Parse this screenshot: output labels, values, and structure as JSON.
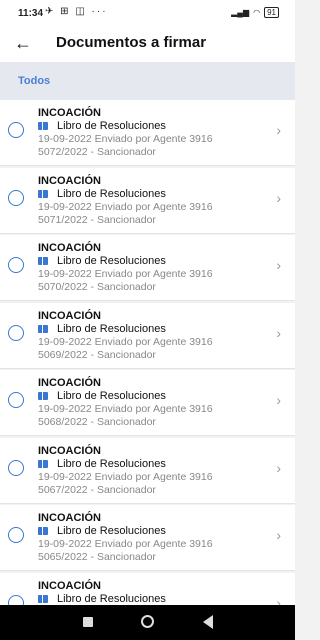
{
  "status_bar": {
    "time": "11:34",
    "left_icons": "✈ ⊞ ◫ ···",
    "battery": "91"
  },
  "header": {
    "back_icon": "arrow-left-icon",
    "title": "Documentos a firmar"
  },
  "tabs": [
    {
      "label": "Todos",
      "active": true
    }
  ],
  "documents": [
    {
      "type": "INCOACIÓN",
      "book": "Libro de Resoluciones",
      "sent": "19-09-2022 Enviado por Agente 3916",
      "ref": "5072/2022 - Sancionador"
    },
    {
      "type": "INCOACIÓN",
      "book": "Libro de Resoluciones",
      "sent": "19-09-2022 Enviado por Agente 3916",
      "ref": "5071/2022 - Sancionador"
    },
    {
      "type": "INCOACIÓN",
      "book": "Libro de Resoluciones",
      "sent": "19-09-2022 Enviado por Agente 3916",
      "ref": "5070/2022 - Sancionador"
    },
    {
      "type": "INCOACIÓN",
      "book": "Libro de Resoluciones",
      "sent": "19-09-2022 Enviado por Agente 3916",
      "ref": "5069/2022 - Sancionador"
    },
    {
      "type": "INCOACIÓN",
      "book": "Libro de Resoluciones",
      "sent": "19-09-2022 Enviado por Agente 3916",
      "ref": "5068/2022 - Sancionador"
    },
    {
      "type": "INCOACIÓN",
      "book": "Libro de Resoluciones",
      "sent": "19-09-2022 Enviado por Agente 3916",
      "ref": "5067/2022 - Sancionador"
    },
    {
      "type": "INCOACIÓN",
      "book": "Libro de Resoluciones",
      "sent": "19-09-2022 Enviado por Agente 3916",
      "ref": "5065/2022 - Sancionador"
    },
    {
      "type": "INCOACIÓN",
      "book": "Libro de Resoluciones",
      "sent": "",
      "ref": ""
    }
  ],
  "colors": {
    "accent": "#3a78d0",
    "tab_text": "#4a7fd4",
    "tab_bg": "#e6e8ef"
  }
}
